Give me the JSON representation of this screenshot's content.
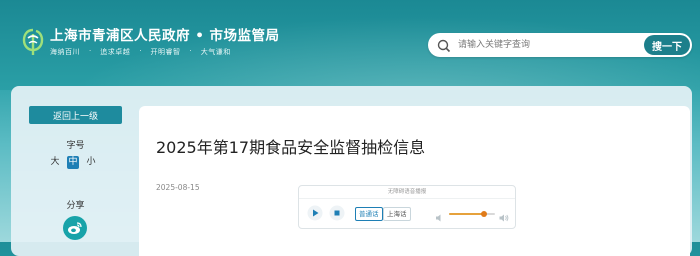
{
  "header": {
    "site_title": "上海市青浦区人民政府 • 市场监管局",
    "slogans": [
      "海纳百川",
      "追求卓越",
      "开明睿智",
      "大气谦和"
    ]
  },
  "search": {
    "placeholder": "请输入关键字查询",
    "button_label": "搜一下"
  },
  "sidebar": {
    "back_label": "返回上一级",
    "font_size_label": "字号",
    "font_sizes": [
      "大",
      "中",
      "小"
    ],
    "font_size_selected": "中",
    "share_label": "分享"
  },
  "article": {
    "title": "2025年第17期食品安全监督抽检信息",
    "date": "2025-08-15"
  },
  "audio_player": {
    "header": "无障碍语音播报",
    "languages": [
      "普通话",
      "上海话"
    ],
    "language_selected": "普通话",
    "volume": 0.75
  },
  "colors": {
    "accent": "#1e8b9e",
    "search_button": "#1c7f8b",
    "active_font": "#1e7fb5",
    "volume_knob": "#e07b1a"
  }
}
